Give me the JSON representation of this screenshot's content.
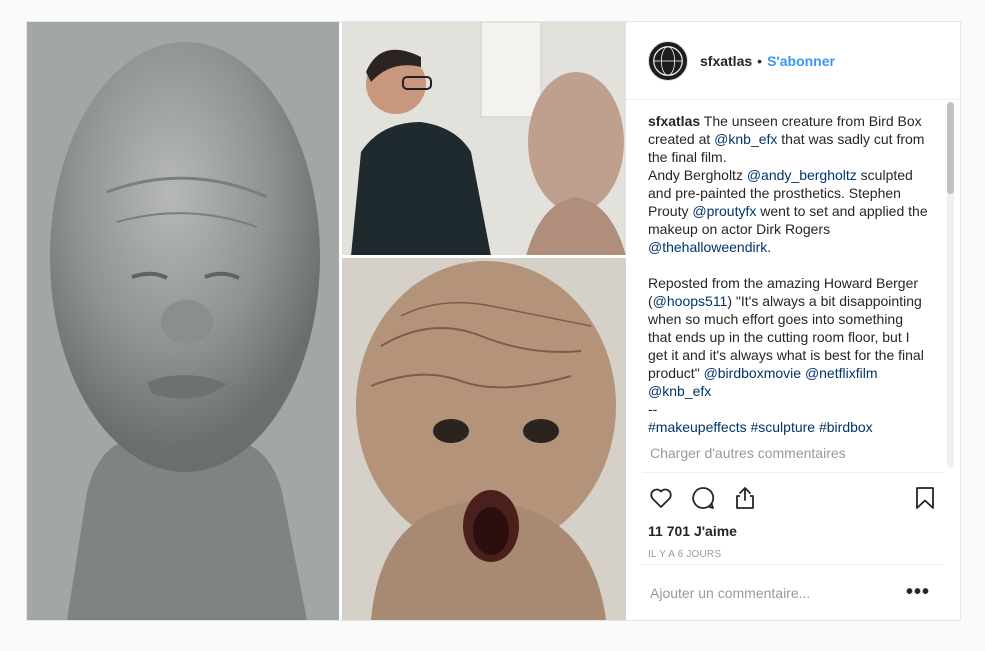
{
  "header": {
    "username": "sfxatlas",
    "separator": "•",
    "follow_label": "S'abonner",
    "avatar_text": "SFX ATLAS"
  },
  "caption": {
    "username": "sfxatlas",
    "line1": " The unseen creature from Bird Box created at ",
    "tag_knb": "@knb_efx",
    "line1b": " that was sadly cut from the final film.",
    "line2a": "Andy Bergholtz ",
    "tag_andy": "@andy_bergholtz",
    "line2b": " sculpted and pre-painted the prosthetics. Stephen Prouty ",
    "tag_prouty": "@proutyfx",
    "line2c": " went to set and applied the makeup on actor Dirk Rogers ",
    "tag_dirk": "@thehalloweendirk",
    "line2d": ".",
    "line3a": "Reposted from the amazing Howard Berger (",
    "tag_hoops": "@hoops511",
    "line3b": ") \"It's always a bit disappointing when so much effort goes into something that ends up in the cutting room floor, but I get it and it's always what is best for the final product\"",
    "tag_birdbox": "@birdboxmovie",
    "tag_netflix": "@netflixfilm",
    "tag_knb2": "@knb_efx",
    "dashes": "--",
    "hashtag1": "#makeupeffects",
    "hashtag2": "#sculpture",
    "hashtag3": "#birdbox"
  },
  "load_more_label": "Charger d'autres commentaires",
  "actions": {
    "icons": [
      "heart-icon",
      "comment-icon",
      "share-icon",
      "bookmark-icon"
    ]
  },
  "likes_label": "11 701 J'aime",
  "timestamp": "IL Y A 6 JOURS",
  "add_comment": {
    "placeholder": "Ajouter un commentaire...",
    "more_label": "•••"
  },
  "colors": {
    "accent": "#3897f0",
    "link": "#003569",
    "muted": "#999999"
  }
}
